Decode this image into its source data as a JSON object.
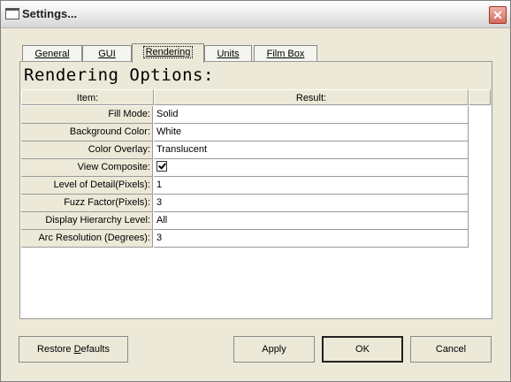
{
  "window": {
    "title": "Settings...",
    "close_glyph": "✕"
  },
  "tabs": [
    {
      "label": "General"
    },
    {
      "label": "GUI"
    },
    {
      "label": "Rendering"
    },
    {
      "label": "Units"
    },
    {
      "label": "Film Box"
    }
  ],
  "active_tab": "Rendering",
  "panel": {
    "title": "Rendering Options:",
    "columns": {
      "item": "Item:",
      "result": "Result:"
    },
    "rows": [
      {
        "item": "Fill Mode:",
        "result": "Solid"
      },
      {
        "item": "Background Color:",
        "result": "White"
      },
      {
        "item": "Color Overlay:",
        "result": "Translucent"
      },
      {
        "item": "View Composite:",
        "result": "",
        "checked": true
      },
      {
        "item": "Level of Detail(Pixels):",
        "result": "1"
      },
      {
        "item": "Fuzz Factor(Pixels):",
        "result": "3"
      },
      {
        "item": "Display Hierarchy Level:",
        "result": "All"
      },
      {
        "item": "Arc Resolution (Degrees):",
        "result": "3"
      }
    ]
  },
  "buttons": {
    "restore": {
      "pre": "Restore ",
      "ul": "D",
      "post": "efaults"
    },
    "apply": "Apply",
    "ok": "OK",
    "cancel": "Cancel"
  }
}
